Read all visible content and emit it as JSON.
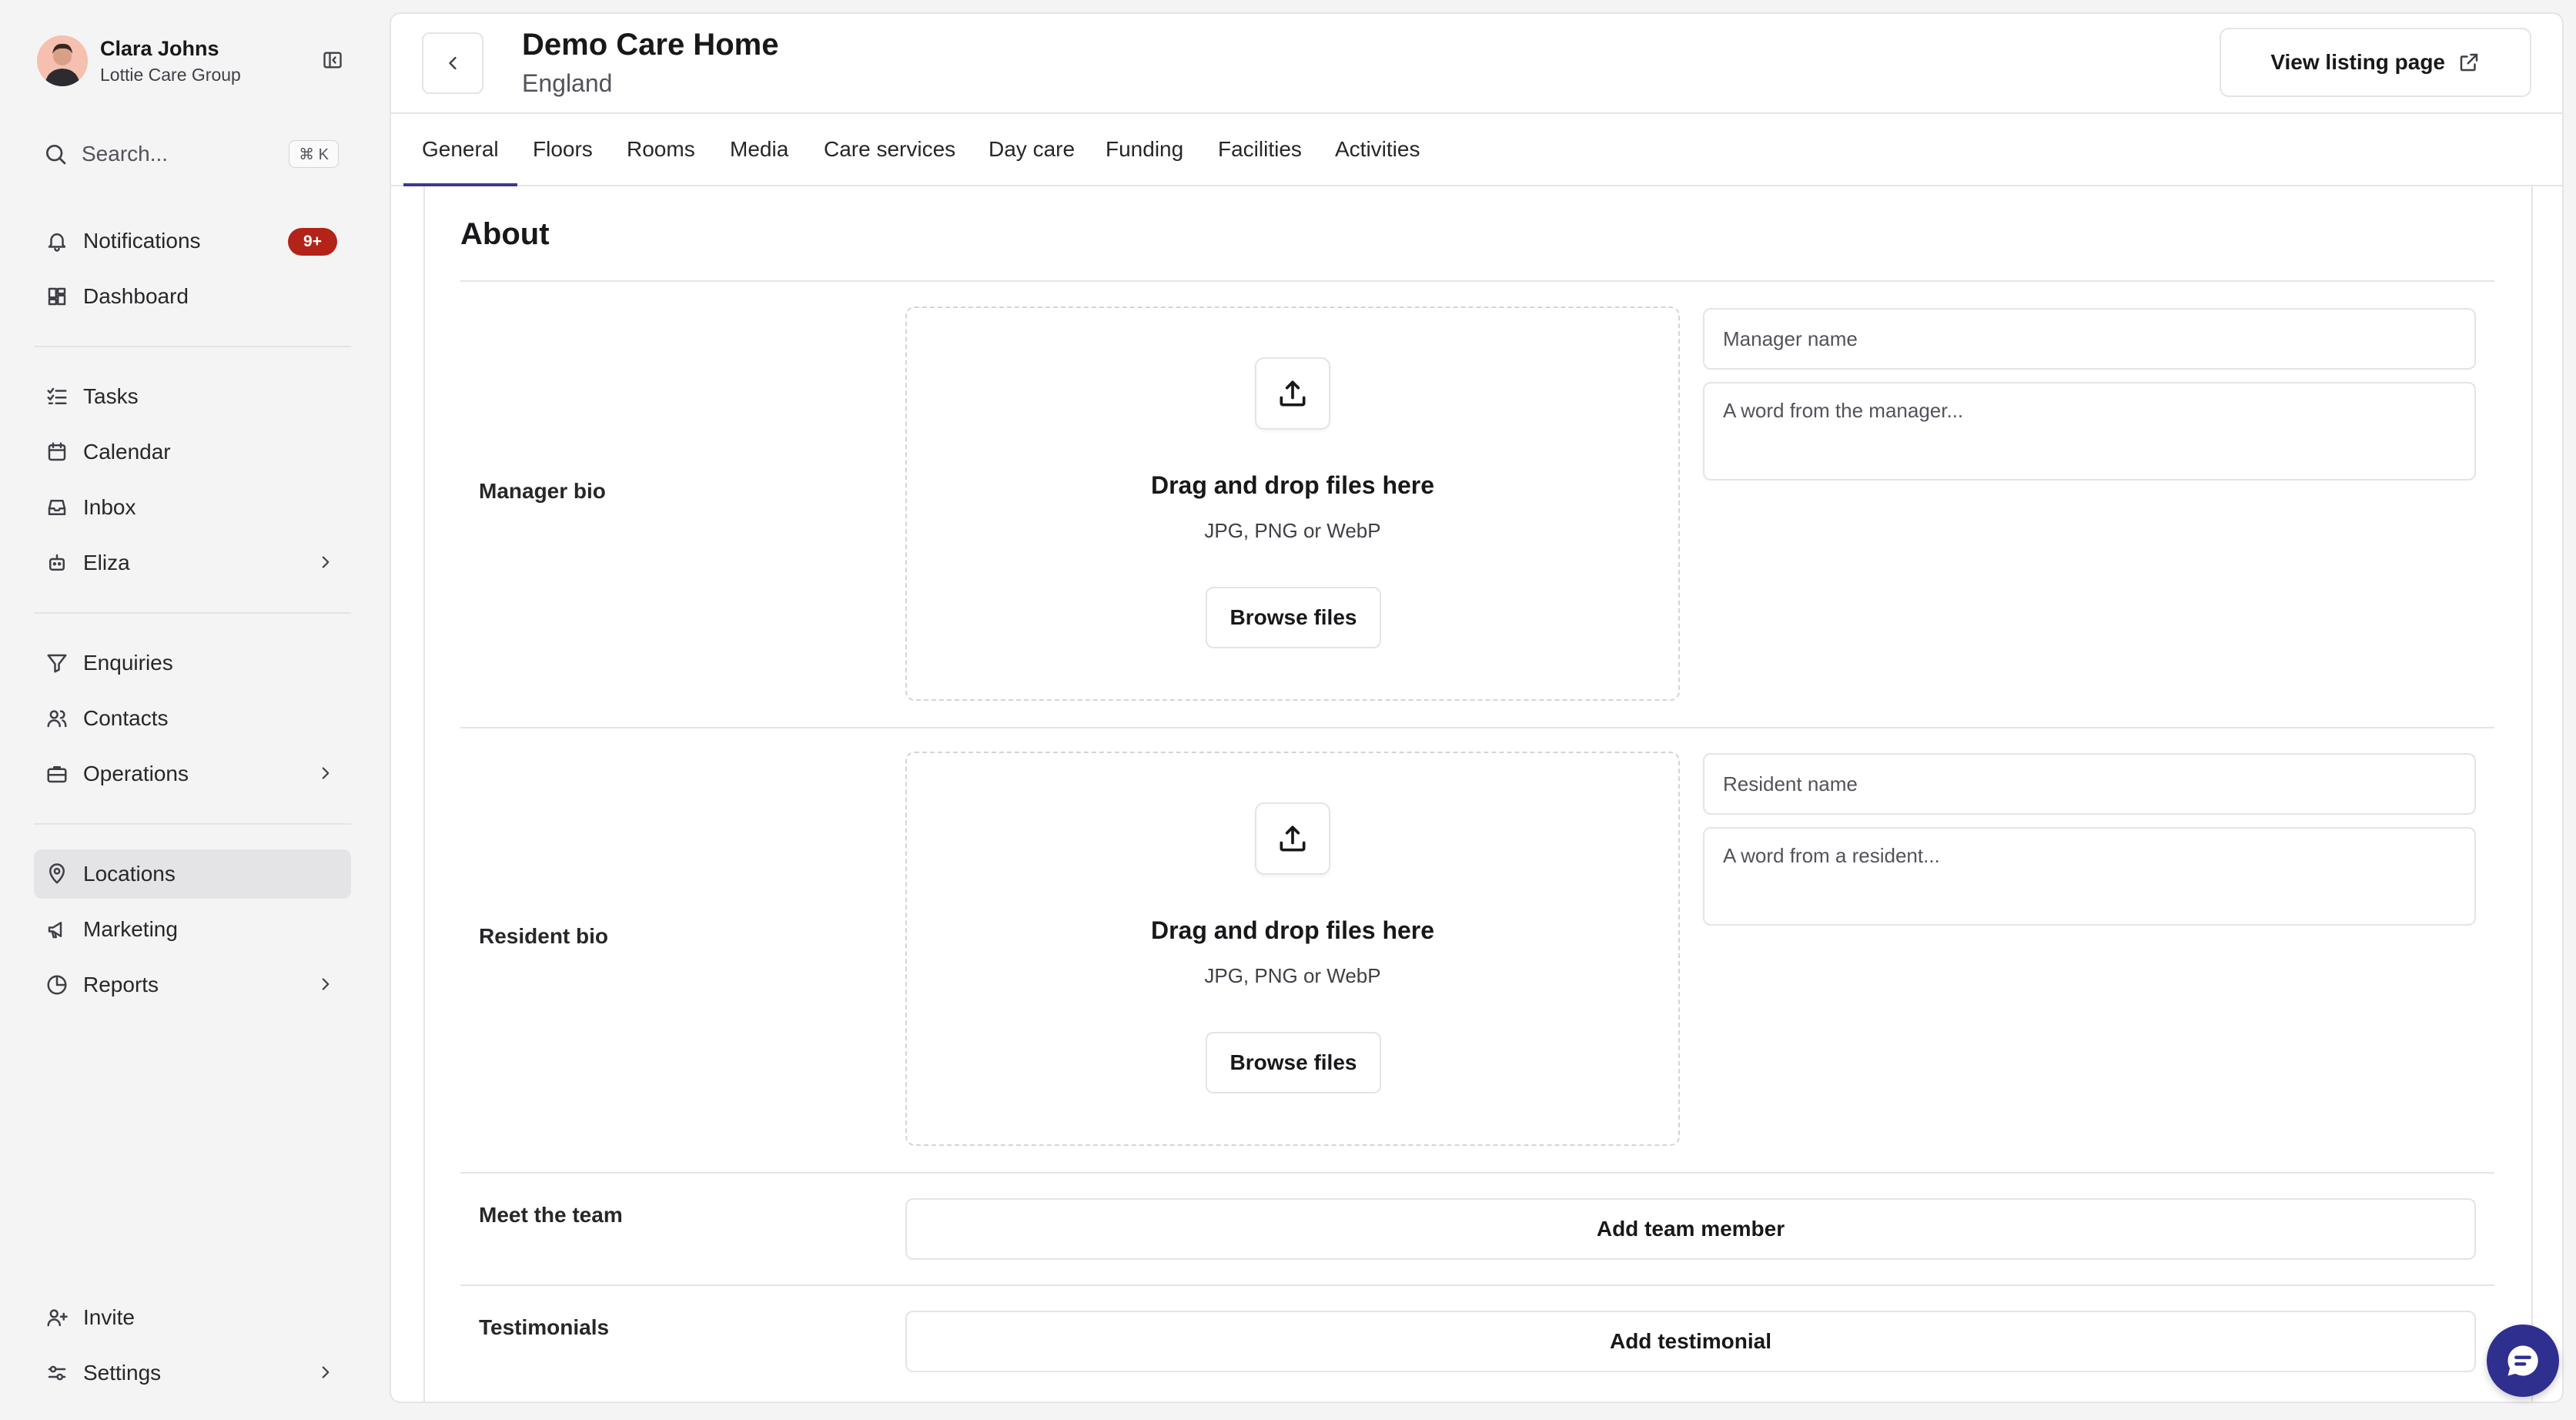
{
  "user": {
    "name": "Clara Johns",
    "org": "Lottie Care Group"
  },
  "search": {
    "placeholder": "Search...",
    "shortcut": "⌘ K"
  },
  "nav": {
    "notifications": {
      "label": "Notifications",
      "badge": "9+"
    },
    "dashboard": "Dashboard",
    "tasks": "Tasks",
    "calendar": "Calendar",
    "inbox": "Inbox",
    "eliza": "Eliza",
    "enquiries": "Enquiries",
    "contacts": "Contacts",
    "operations": "Operations",
    "locations": "Locations",
    "marketing": "Marketing",
    "reports": "Reports",
    "invite": "Invite",
    "settings": "Settings",
    "active": "Locations"
  },
  "header": {
    "title": "Demo Care Home",
    "subtitle": "England",
    "listing_button": "View listing page"
  },
  "tabs": [
    "General",
    "Floors",
    "Rooms",
    "Media",
    "Care services",
    "Day care",
    "Funding",
    "Facilities",
    "Activities"
  ],
  "active_tab": "General",
  "about": {
    "title": "About",
    "manager": {
      "label": "Manager bio",
      "drop_title": "Drag and drop files here",
      "drop_sub": "JPG, PNG or WebP",
      "browse": "Browse files",
      "name_placeholder": "Manager name",
      "word_placeholder": "A word from the manager..."
    },
    "resident": {
      "label": "Resident bio",
      "drop_title": "Drag and drop files here",
      "drop_sub": "JPG, PNG or WebP",
      "browse": "Browse files",
      "name_placeholder": "Resident name",
      "word_placeholder": "A word from a resident..."
    },
    "team": {
      "label": "Meet the team",
      "button": "Add team member"
    },
    "testimonials": {
      "label": "Testimonials",
      "button": "Add testimonial"
    }
  },
  "colors": {
    "accent": "#2f2f8f",
    "badge": "#b42318",
    "active_nav": "#e4e4e7"
  }
}
